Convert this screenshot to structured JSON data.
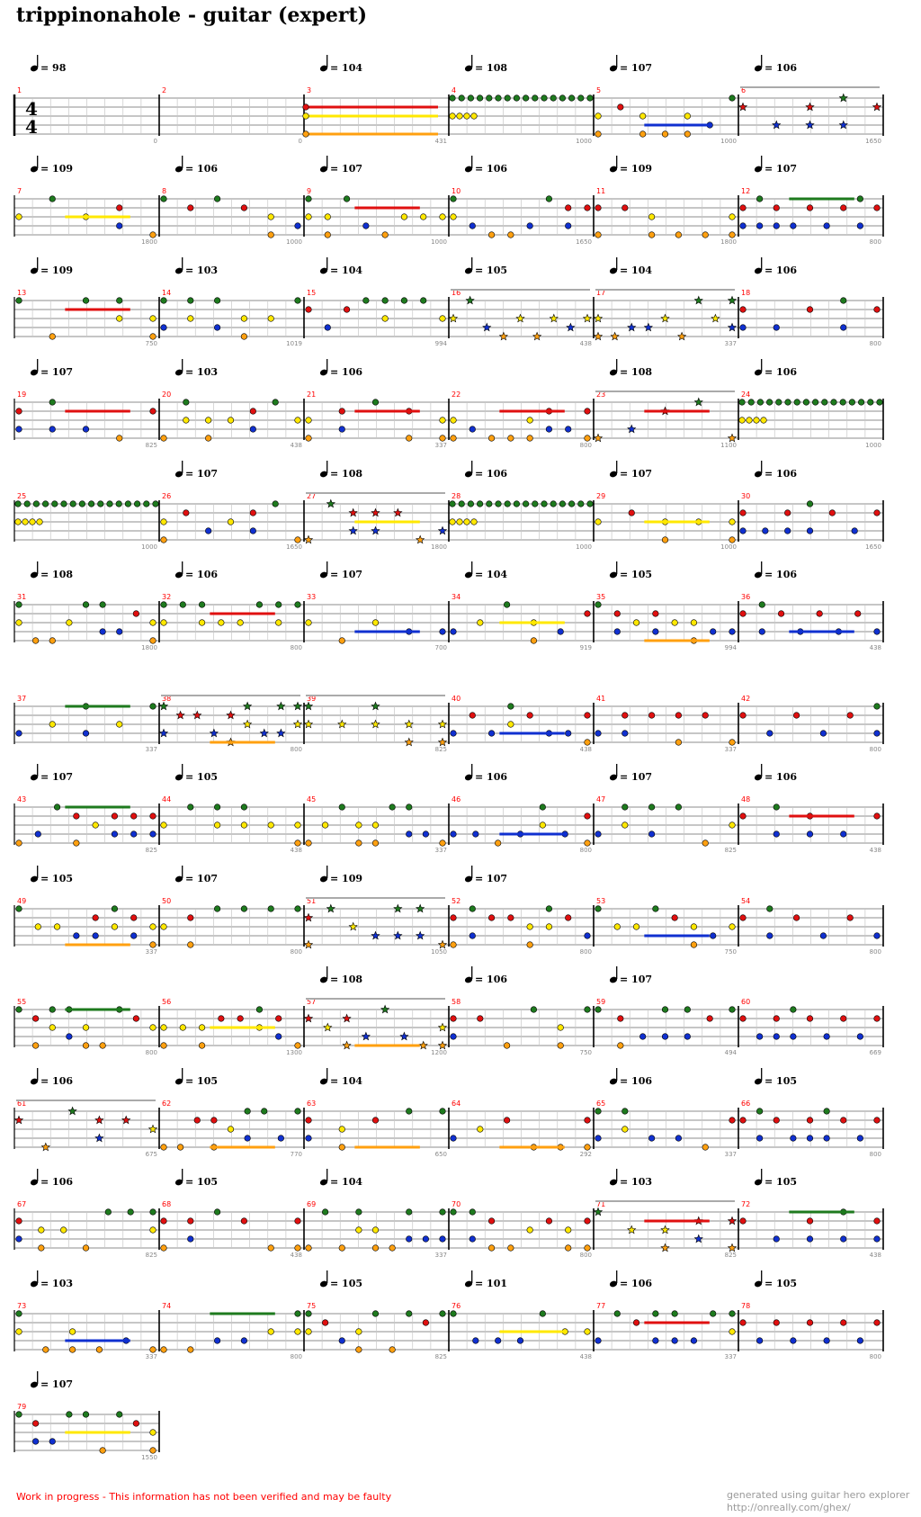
{
  "page": {
    "title": "trippinonahole - guitar (expert)",
    "time_signature": {
      "top": "4",
      "bottom": "4"
    },
    "disclaimer": "Work in progress - This information has not been verified and may be faulty",
    "credit_line1": "generated using guitar hero explorer",
    "credit_line2": "http://onreally.com/ghex/"
  },
  "colors": {
    "green": "#1e7a1e",
    "red": "#e01010",
    "yellow": "#ffe800",
    "blue": "#1030d0",
    "orange": "#ffa010",
    "measure_number": "#ff0000",
    "grid": "#c8c8c8",
    "sp_bar": "#aaaaaa"
  },
  "rows": [
    {
      "tempos": [
        {
          "m": 1,
          "bpm": "98"
        },
        {
          "m": 3,
          "bpm": "104"
        },
        {
          "m": 4,
          "bpm": "108"
        },
        {
          "m": 5,
          "bpm": "107"
        },
        {
          "m": 6,
          "bpm": "106"
        }
      ],
      "measures": [
        1,
        2,
        3,
        4,
        5,
        6
      ],
      "scores": [
        {
          "m": 2,
          "v": "0"
        },
        {
          "m": 3,
          "v": "0"
        },
        {
          "m": 4,
          "v": "431"
        },
        {
          "m": 5,
          "v": "1000"
        },
        {
          "m": 6,
          "v": "1000"
        },
        {
          "m": 7,
          "v": "1650"
        }
      ]
    },
    {
      "tempos": [
        {
          "m": 7,
          "bpm": "109"
        },
        {
          "m": 8,
          "bpm": "106"
        },
        {
          "m": 9,
          "bpm": "107"
        },
        {
          "m": 10,
          "bpm": "106"
        },
        {
          "m": 11,
          "bpm": "109"
        },
        {
          "m": 12,
          "bpm": "107"
        }
      ],
      "measures": [
        7,
        8,
        9,
        10,
        11,
        12
      ],
      "scores": [
        {
          "m": 8,
          "v": "1800"
        },
        {
          "m": 9,
          "v": "1000"
        },
        {
          "m": 10,
          "v": "1000"
        },
        {
          "m": 11,
          "v": "1650"
        },
        {
          "m": 12,
          "v": "1800"
        },
        {
          "m": 13,
          "v": "800"
        }
      ]
    },
    {
      "tempos": [
        {
          "m": 13,
          "bpm": "109"
        },
        {
          "m": 14,
          "bpm": "103"
        },
        {
          "m": 15,
          "bpm": "104"
        },
        {
          "m": 16,
          "bpm": "105"
        },
        {
          "m": 17,
          "bpm": "104"
        },
        {
          "m": 18,
          "bpm": "106"
        }
      ],
      "measures": [
        13,
        14,
        15,
        16,
        17,
        18
      ],
      "scores": [
        {
          "m": 14,
          "v": "750"
        },
        {
          "m": 15,
          "v": "1019"
        },
        {
          "m": 16,
          "v": "994"
        },
        {
          "m": 17,
          "v": "438"
        },
        {
          "m": 18,
          "v": "337"
        },
        {
          "m": 19,
          "v": "800"
        }
      ]
    },
    {
      "tempos": [
        {
          "m": 19,
          "bpm": "107"
        },
        {
          "m": 20,
          "bpm": "103"
        },
        {
          "m": 21,
          "bpm": "106"
        },
        {
          "m": 23,
          "bpm": "108"
        },
        {
          "m": 24,
          "bpm": "106"
        }
      ],
      "measures": [
        19,
        20,
        21,
        22,
        23,
        24
      ],
      "scores": [
        {
          "m": 20,
          "v": "825"
        },
        {
          "m": 21,
          "v": "438"
        },
        {
          "m": 22,
          "v": "337"
        },
        {
          "m": 23,
          "v": "800"
        },
        {
          "m": 24,
          "v": "1100"
        },
        {
          "m": 25,
          "v": "1000"
        }
      ]
    },
    {
      "tempos": [
        {
          "m": 26,
          "bpm": "107"
        },
        {
          "m": 27,
          "bpm": "108"
        },
        {
          "m": 28,
          "bpm": "106"
        },
        {
          "m": 29,
          "bpm": "107"
        },
        {
          "m": 30,
          "bpm": "106"
        }
      ],
      "measures": [
        25,
        26,
        27,
        28,
        29,
        30
      ],
      "scores": [
        {
          "m": 26,
          "v": "1000"
        },
        {
          "m": 27,
          "v": "1650"
        },
        {
          "m": 28,
          "v": "1800"
        },
        {
          "m": 29,
          "v": "1000"
        },
        {
          "m": 30,
          "v": "1000"
        },
        {
          "m": 31,
          "v": "1650"
        }
      ]
    },
    {
      "tempos": [
        {
          "m": 31,
          "bpm": "108"
        },
        {
          "m": 32,
          "bpm": "106"
        },
        {
          "m": 33,
          "bpm": "107"
        },
        {
          "m": 34,
          "bpm": "104"
        },
        {
          "m": 35,
          "bpm": "105"
        },
        {
          "m": 36,
          "bpm": "106"
        }
      ],
      "measures": [
        31,
        32,
        33,
        34,
        35,
        36
      ],
      "scores": [
        {
          "m": 32,
          "v": "1800"
        },
        {
          "m": 33,
          "v": "800"
        },
        {
          "m": 34,
          "v": "700"
        },
        {
          "m": 35,
          "v": "919"
        },
        {
          "m": 36,
          "v": "994"
        },
        {
          "m": 37,
          "v": "438"
        }
      ]
    },
    {
      "tempos": [],
      "measures": [
        37,
        38,
        39,
        40,
        41,
        42
      ],
      "scores": [
        {
          "m": 38,
          "v": "337"
        },
        {
          "m": 39,
          "v": "800"
        },
        {
          "m": 40,
          "v": "825"
        },
        {
          "m": 41,
          "v": "438"
        },
        {
          "m": 42,
          "v": "337"
        },
        {
          "m": 43,
          "v": "800"
        }
      ]
    },
    {
      "tempos": [
        {
          "m": 37,
          "bpm": "107"
        },
        {
          "m": 38,
          "bpm": "105"
        },
        {
          "m": 40,
          "bpm": "106"
        },
        {
          "m": 41,
          "bpm": "107"
        },
        {
          "m": 42,
          "bpm": "106"
        }
      ],
      "measures": [
        43,
        44,
        45,
        46,
        47,
        48
      ],
      "scores": [
        {
          "m": 44,
          "v": "825"
        },
        {
          "m": 45,
          "v": "438"
        },
        {
          "m": 46,
          "v": "337"
        },
        {
          "m": 47,
          "v": "800"
        },
        {
          "m": 48,
          "v": "825"
        },
        {
          "m": 49,
          "v": "438"
        }
      ]
    },
    {
      "tempos": [
        {
          "m": 43,
          "bpm": "105"
        },
        {
          "m": 44,
          "bpm": "107"
        },
        {
          "m": 45,
          "bpm": "109"
        },
        {
          "m": 46,
          "bpm": "107"
        }
      ],
      "measures": [
        49,
        50,
        51,
        52,
        53,
        54
      ],
      "scores": [
        {
          "m": 50,
          "v": "337"
        },
        {
          "m": 51,
          "v": "800"
        },
        {
          "m": 52,
          "v": "1050"
        },
        {
          "m": 53,
          "v": "800"
        },
        {
          "m": 54,
          "v": "750"
        },
        {
          "m": 55,
          "v": "800"
        }
      ]
    },
    {
      "tempos": [
        {
          "m": 51,
          "bpm": "108"
        },
        {
          "m": 52,
          "bpm": "106"
        },
        {
          "m": 53,
          "bpm": "107"
        }
      ],
      "measures": [
        55,
        56,
        57,
        58,
        59,
        60
      ],
      "scores": [
        {
          "m": 56,
          "v": "800"
        },
        {
          "m": 57,
          "v": "1300"
        },
        {
          "m": 58,
          "v": "1200"
        },
        {
          "m": 59,
          "v": "750"
        },
        {
          "m": 60,
          "v": "494"
        },
        {
          "m": 61,
          "v": "669"
        }
      ]
    },
    {
      "tempos": [
        {
          "m": 55,
          "bpm": "106"
        },
        {
          "m": 56,
          "bpm": "105"
        },
        {
          "m": 57,
          "bpm": "104"
        },
        {
          "m": 59,
          "bpm": "106"
        },
        {
          "m": 60,
          "bpm": "105"
        }
      ],
      "measures": [
        61,
        62,
        63,
        64,
        65,
        66
      ],
      "scores": [
        {
          "m": 62,
          "v": "675"
        },
        {
          "m": 63,
          "v": "770"
        },
        {
          "m": 64,
          "v": "650"
        },
        {
          "m": 65,
          "v": "292"
        },
        {
          "m": 66,
          "v": "337"
        },
        {
          "m": 67,
          "v": "800"
        }
      ]
    },
    {
      "tempos": [
        {
          "m": 61,
          "bpm": "106"
        },
        {
          "m": 62,
          "bpm": "105"
        },
        {
          "m": 63,
          "bpm": "104"
        },
        {
          "m": 65,
          "bpm": "103"
        },
        {
          "m": 66,
          "bpm": "105"
        }
      ],
      "measures": [
        67,
        68,
        69,
        70,
        71,
        72
      ],
      "scores": [
        {
          "m": 68,
          "v": "825"
        },
        {
          "m": 69,
          "v": "438"
        },
        {
          "m": 70,
          "v": "337"
        },
        {
          "m": 71,
          "v": "800"
        },
        {
          "m": 72,
          "v": "825"
        },
        {
          "m": 73,
          "v": "438"
        }
      ]
    },
    {
      "tempos": [
        {
          "m": 67,
          "bpm": "103"
        },
        {
          "m": 69,
          "bpm": "105"
        },
        {
          "m": 70,
          "bpm": "101"
        },
        {
          "m": 71,
          "bpm": "106"
        },
        {
          "m": 72,
          "bpm": "105"
        }
      ],
      "measures": [
        73,
        74,
        75,
        76,
        77,
        78
      ],
      "scores": [
        {
          "m": 74,
          "v": "337"
        },
        {
          "m": 75,
          "v": "800"
        },
        {
          "m": 76,
          "v": "825"
        },
        {
          "m": 77,
          "v": "438"
        },
        {
          "m": 78,
          "v": "337"
        },
        {
          "m": 79,
          "v": "800"
        }
      ]
    },
    {
      "tempos": [
        {
          "m": 73,
          "bpm": "107"
        }
      ],
      "measures": [
        79
      ],
      "scores": [
        {
          "m": 80,
          "v": "1550"
        }
      ]
    }
  ]
}
